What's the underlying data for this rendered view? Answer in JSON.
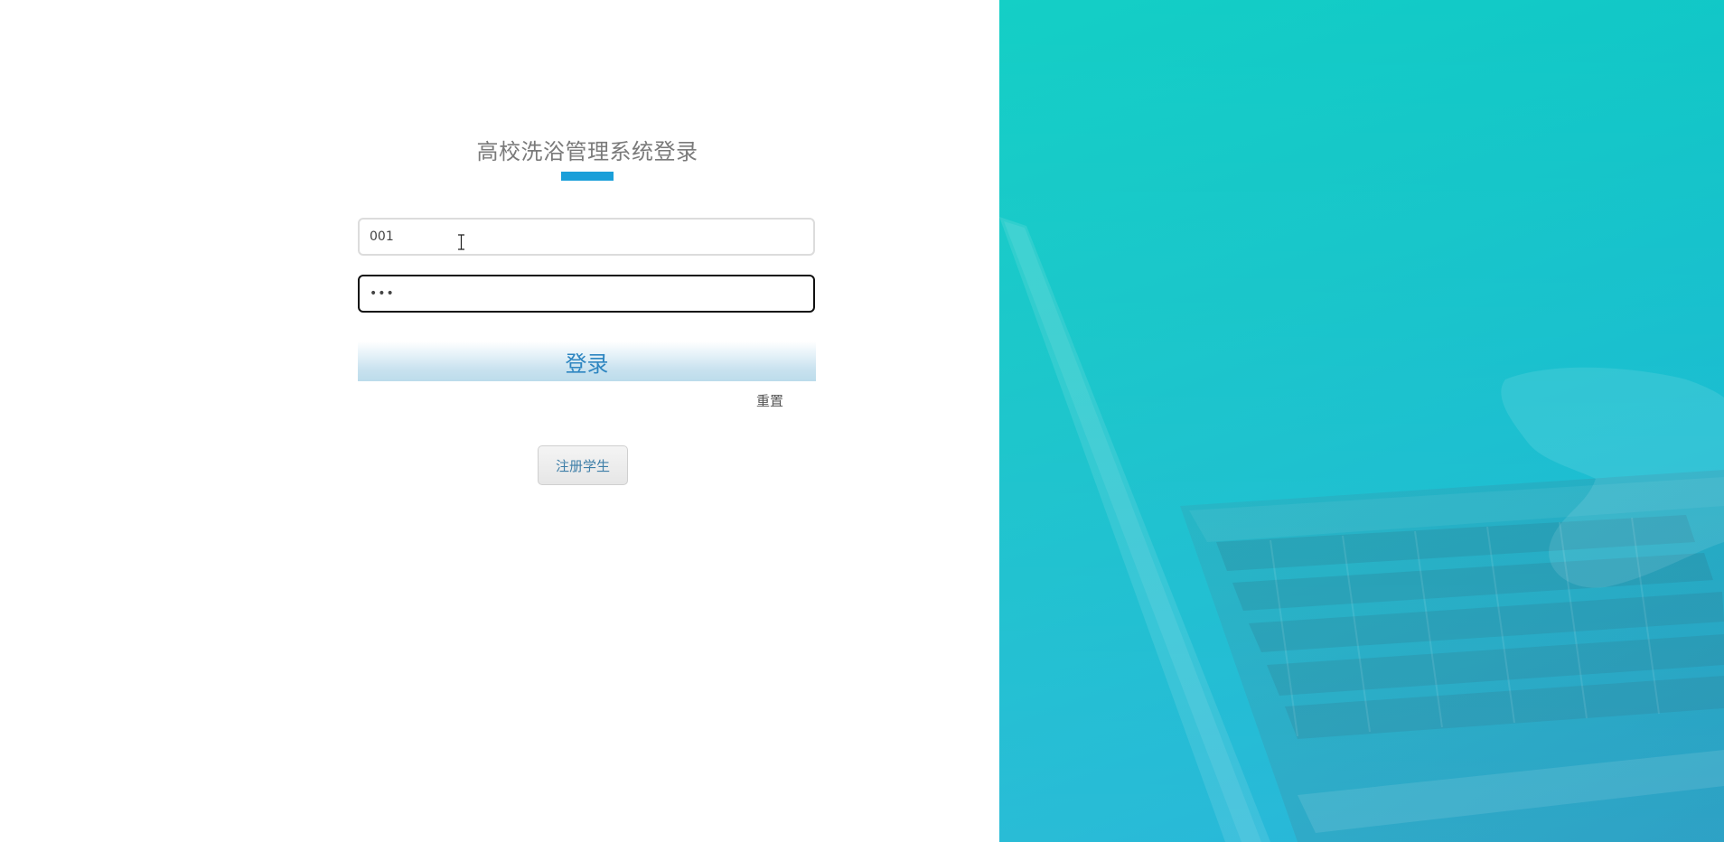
{
  "login": {
    "title": "高校洗浴管理系统登录",
    "username_value": "001",
    "password_value": "•••",
    "login_label": "登录",
    "reset_label": "重置",
    "register_label": "注册学生"
  },
  "colors": {
    "accent": "#1a9fd9",
    "hero_start": "#14cfc6",
    "hero_end": "#0aa9d6"
  },
  "icons": {
    "text_cursor": "text-cursor-icon",
    "background_art": "laptop-illustration"
  }
}
